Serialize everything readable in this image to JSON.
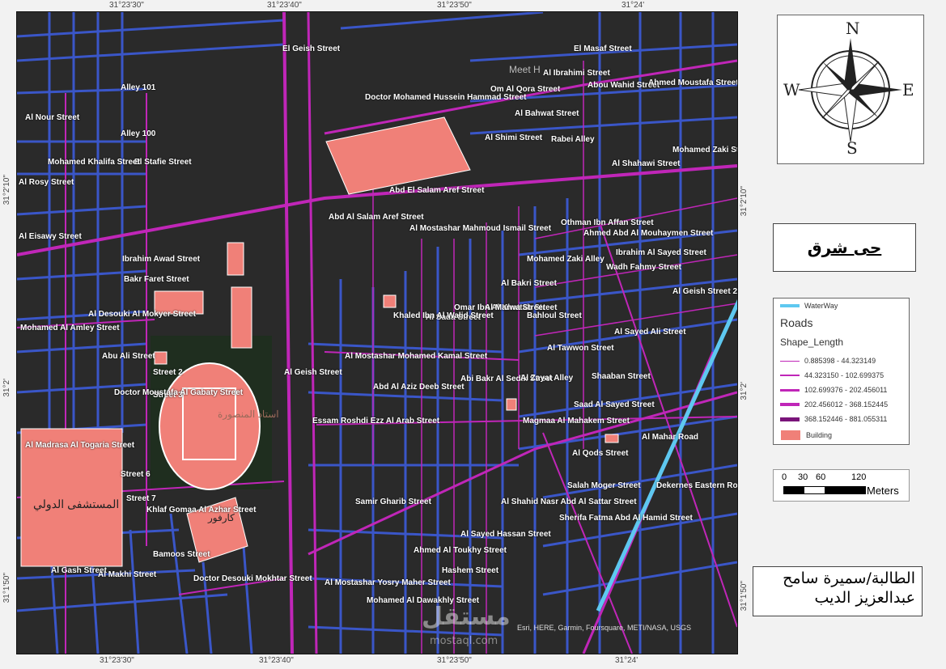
{
  "coords": {
    "top": [
      "31°23'30\"",
      "31°23'40\"",
      "31°23'50\"",
      "31°24'"
    ],
    "bottom": [
      "31°23'30\"",
      "31°23'40\"",
      "31°23'50\"",
      "31°24'"
    ],
    "left": [
      "31°2'10\"",
      "31°2'",
      "31°1'50\""
    ],
    "right": [
      "31°2'10\"",
      "31°2'",
      "31°1'50\""
    ]
  },
  "streets": [
    "Alley 101",
    "Alley 100",
    "El Stafie Street",
    "Al Nour Street",
    "Mohamed Khalifa Street",
    "Al Rosy Street",
    "Al Eisawy Street",
    "El Geish Street",
    "Doctor Mohamed Hussein Hammad Street",
    "Om Al Qora Street",
    "Al Ibrahimi Street",
    "El Masaf Street",
    "Abou Wahid Street",
    "Ahmed Moustafa Street",
    "Al Bahwat Street",
    "Al Shimi Street",
    "Rabei Alley",
    "Al Shahawi Street",
    "Mohamed Zaki Street",
    "Abd El Salam Aref Street",
    "Abd Al Salam Aref Street",
    "Al Mostashar Mahmoud Ismail Street",
    "Ahmed Abd Al Mouhaymen Street",
    "Ibrahim Al Sayed Street",
    "Wadh Fahmy Street",
    "Ibrahim Awad Street",
    "Bakr Faret Street",
    "Al Desouki Al Mokyer Street",
    "Mohamed Al Amley Street",
    "Abu Ali Street",
    "Street 2",
    "Street 3",
    "Doctor Moustafa Al Gabaty Street",
    "Street 6",
    "Street 7",
    "Khlaf Gomaa Al Azhar Street",
    "Al Madrasa Al Togaria Street",
    "Al Sada Street",
    "Omar Ibn Al Khattab Street",
    "Khaled Ibn Al Walid Street",
    "Al Marwa Street",
    "Al Bakri Street",
    "Al Mostashar Mohamed Kamal Street",
    "Abd Al Aziz Deeb Street",
    "Al Geish Street",
    "Essam Roshdi Ezz Al Arab Street",
    "Abi Bakr Al Sedik Street",
    "Al Zayat Alley",
    "Al Tawwon Street",
    "Shaaban Street",
    "Saad Al Sayed Street",
    "Magmaa Al Mahakem Street",
    "Al Qods Street",
    "Samir Gharib Street",
    "Salah Moger Street",
    "Al Shahid Nasr Abd Al Sattar Street",
    "Al Sayed Hassan Street",
    "Ahmed Al Toukhy Street",
    "Hashem Street",
    "Mohamed Al Dawakhly Street",
    "Al Mostashar Yosry Maher Street",
    "Doctor Desouki Mokhtar Street",
    "Al Gash Street",
    "Al Makhi Street",
    "Bamoos Street",
    "Al Mahar Road",
    "Dekernes Eastern Road",
    "Sherifa Fatma Abd Al Hamid Street",
    "Mohamed Zaki Alley",
    "Bahloul Street",
    "Al Sayed Ali Street",
    "Al Geish Street 2",
    "Othman Ibn Affan Street",
    "Meet H"
  ],
  "arabic_labels": [
    "المستشفى الدولي",
    "كارفور",
    "استاد المنصورة"
  ],
  "attribution": "Esri, HERE, Garmin, Foursquare, METI/NASA, USGS",
  "watermark": {
    "brand": "مستقل",
    "url": "mostaql.com"
  },
  "compass": {
    "n": "N",
    "s": "S",
    "e": "E",
    "w": "W"
  },
  "district_title": "حى شرق",
  "legend": {
    "waterway": "WaterWay",
    "roads_title": "Roads",
    "field": "Shape_Length",
    "classes": [
      "0.885398 - 44.323149",
      "44.323150 - 102.699375",
      "102.699376 - 202.456011",
      "202.456012 - 368.152445",
      "368.152446 - 881.055311"
    ],
    "building": "Building"
  },
  "scale": {
    "ticks": [
      "0",
      "30",
      "60",
      "120"
    ],
    "unit": "Meters"
  },
  "student": {
    "line1": "الطالبة/سميرة سامح",
    "line2": "عبدالعزيز الديب"
  },
  "colors": {
    "background": "#2a2a2a",
    "blue_roads": "#3a56c8",
    "magenta_roads": "#c026b8",
    "building": "#f08078",
    "waterway": "#5ec8f0",
    "stadium_green": "#1f2e1f"
  }
}
